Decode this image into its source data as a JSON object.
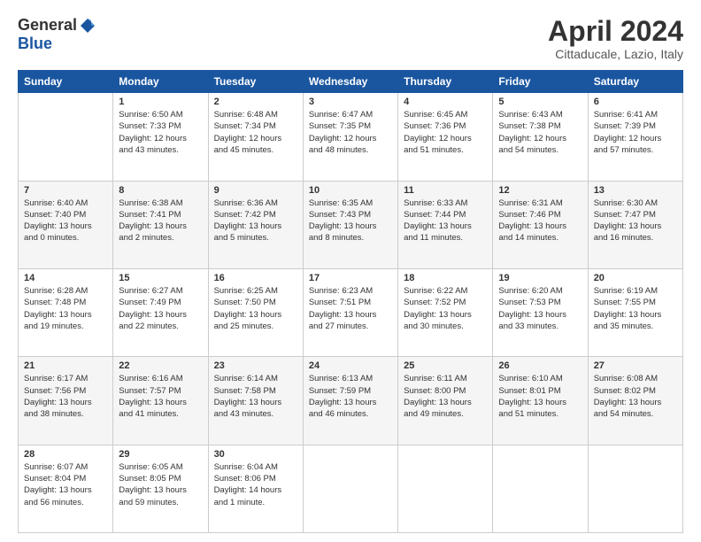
{
  "header": {
    "logo_general": "General",
    "logo_blue": "Blue",
    "title": "April 2024",
    "location": "Cittaducale, Lazio, Italy"
  },
  "days_of_week": [
    "Sunday",
    "Monday",
    "Tuesday",
    "Wednesday",
    "Thursday",
    "Friday",
    "Saturday"
  ],
  "weeks": [
    [
      {
        "day": "",
        "info": ""
      },
      {
        "day": "1",
        "info": "Sunrise: 6:50 AM\nSunset: 7:33 PM\nDaylight: 12 hours\nand 43 minutes."
      },
      {
        "day": "2",
        "info": "Sunrise: 6:48 AM\nSunset: 7:34 PM\nDaylight: 12 hours\nand 45 minutes."
      },
      {
        "day": "3",
        "info": "Sunrise: 6:47 AM\nSunset: 7:35 PM\nDaylight: 12 hours\nand 48 minutes."
      },
      {
        "day": "4",
        "info": "Sunrise: 6:45 AM\nSunset: 7:36 PM\nDaylight: 12 hours\nand 51 minutes."
      },
      {
        "day": "5",
        "info": "Sunrise: 6:43 AM\nSunset: 7:38 PM\nDaylight: 12 hours\nand 54 minutes."
      },
      {
        "day": "6",
        "info": "Sunrise: 6:41 AM\nSunset: 7:39 PM\nDaylight: 12 hours\nand 57 minutes."
      }
    ],
    [
      {
        "day": "7",
        "info": "Sunrise: 6:40 AM\nSunset: 7:40 PM\nDaylight: 13 hours\nand 0 minutes."
      },
      {
        "day": "8",
        "info": "Sunrise: 6:38 AM\nSunset: 7:41 PM\nDaylight: 13 hours\nand 2 minutes."
      },
      {
        "day": "9",
        "info": "Sunrise: 6:36 AM\nSunset: 7:42 PM\nDaylight: 13 hours\nand 5 minutes."
      },
      {
        "day": "10",
        "info": "Sunrise: 6:35 AM\nSunset: 7:43 PM\nDaylight: 13 hours\nand 8 minutes."
      },
      {
        "day": "11",
        "info": "Sunrise: 6:33 AM\nSunset: 7:44 PM\nDaylight: 13 hours\nand 11 minutes."
      },
      {
        "day": "12",
        "info": "Sunrise: 6:31 AM\nSunset: 7:46 PM\nDaylight: 13 hours\nand 14 minutes."
      },
      {
        "day": "13",
        "info": "Sunrise: 6:30 AM\nSunset: 7:47 PM\nDaylight: 13 hours\nand 16 minutes."
      }
    ],
    [
      {
        "day": "14",
        "info": "Sunrise: 6:28 AM\nSunset: 7:48 PM\nDaylight: 13 hours\nand 19 minutes."
      },
      {
        "day": "15",
        "info": "Sunrise: 6:27 AM\nSunset: 7:49 PM\nDaylight: 13 hours\nand 22 minutes."
      },
      {
        "day": "16",
        "info": "Sunrise: 6:25 AM\nSunset: 7:50 PM\nDaylight: 13 hours\nand 25 minutes."
      },
      {
        "day": "17",
        "info": "Sunrise: 6:23 AM\nSunset: 7:51 PM\nDaylight: 13 hours\nand 27 minutes."
      },
      {
        "day": "18",
        "info": "Sunrise: 6:22 AM\nSunset: 7:52 PM\nDaylight: 13 hours\nand 30 minutes."
      },
      {
        "day": "19",
        "info": "Sunrise: 6:20 AM\nSunset: 7:53 PM\nDaylight: 13 hours\nand 33 minutes."
      },
      {
        "day": "20",
        "info": "Sunrise: 6:19 AM\nSunset: 7:55 PM\nDaylight: 13 hours\nand 35 minutes."
      }
    ],
    [
      {
        "day": "21",
        "info": "Sunrise: 6:17 AM\nSunset: 7:56 PM\nDaylight: 13 hours\nand 38 minutes."
      },
      {
        "day": "22",
        "info": "Sunrise: 6:16 AM\nSunset: 7:57 PM\nDaylight: 13 hours\nand 41 minutes."
      },
      {
        "day": "23",
        "info": "Sunrise: 6:14 AM\nSunset: 7:58 PM\nDaylight: 13 hours\nand 43 minutes."
      },
      {
        "day": "24",
        "info": "Sunrise: 6:13 AM\nSunset: 7:59 PM\nDaylight: 13 hours\nand 46 minutes."
      },
      {
        "day": "25",
        "info": "Sunrise: 6:11 AM\nSunset: 8:00 PM\nDaylight: 13 hours\nand 49 minutes."
      },
      {
        "day": "26",
        "info": "Sunrise: 6:10 AM\nSunset: 8:01 PM\nDaylight: 13 hours\nand 51 minutes."
      },
      {
        "day": "27",
        "info": "Sunrise: 6:08 AM\nSunset: 8:02 PM\nDaylight: 13 hours\nand 54 minutes."
      }
    ],
    [
      {
        "day": "28",
        "info": "Sunrise: 6:07 AM\nSunset: 8:04 PM\nDaylight: 13 hours\nand 56 minutes."
      },
      {
        "day": "29",
        "info": "Sunrise: 6:05 AM\nSunset: 8:05 PM\nDaylight: 13 hours\nand 59 minutes."
      },
      {
        "day": "30",
        "info": "Sunrise: 6:04 AM\nSunset: 8:06 PM\nDaylight: 14 hours\nand 1 minute."
      },
      {
        "day": "",
        "info": ""
      },
      {
        "day": "",
        "info": ""
      },
      {
        "day": "",
        "info": ""
      },
      {
        "day": "",
        "info": ""
      }
    ]
  ]
}
